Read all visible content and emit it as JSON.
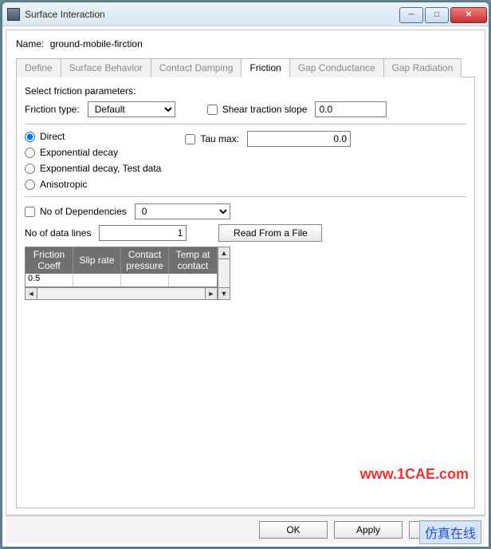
{
  "window": {
    "title": "Surface Interaction"
  },
  "name": {
    "label": "Name:",
    "value": "ground-mobile-firction"
  },
  "tabs": [
    "Define",
    "Surface Behavior",
    "Contact Damping",
    "Friction",
    "Gap Conductance",
    "Gap Radiation"
  ],
  "tab_active": 3,
  "friction": {
    "select_params": "Select friction parameters:",
    "type_label": "Friction type:",
    "type_value": "Default",
    "shear_label": "Shear traction slope",
    "shear_checked": false,
    "shear_value": "0.0",
    "method_options": [
      "Direct",
      "Exponential decay",
      "Exponential decay, Test data",
      "Anisotropic"
    ],
    "method_selected": 0,
    "tau_label": "Tau max:",
    "tau_checked": false,
    "tau_value": "0.0",
    "deps_label": "No of Dependencies",
    "deps_checked": false,
    "deps_value": "0",
    "lines_label": "No of data lines",
    "lines_value": "1",
    "read_file": "Read From a File",
    "headers": [
      "Friction Coeff",
      "Slip rate",
      "Contact pressure",
      "Temp at contact"
    ],
    "rows": [
      [
        "0.5",
        "",
        "",
        ""
      ]
    ]
  },
  "footer": {
    "ok": "OK",
    "apply": "Apply",
    "cancel": "Cancel"
  },
  "watermarks": {
    "url": "www.1CAE.com",
    "brand": "仿真在线"
  }
}
